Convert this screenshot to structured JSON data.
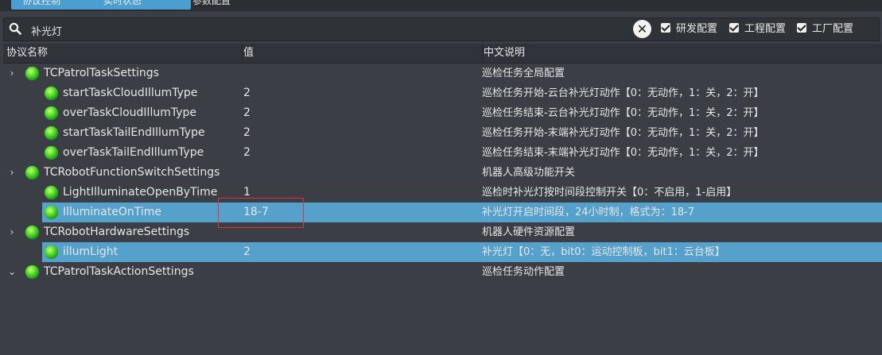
{
  "tabs": [
    {
      "label": "协议控制"
    },
    {
      "label": "实时状态"
    },
    {
      "label": "参数配置"
    }
  ],
  "search": {
    "value": "补光灯",
    "clear_label": "✕"
  },
  "filters": [
    {
      "label": "研发配置",
      "checked": true
    },
    {
      "label": "工程配置",
      "checked": true
    },
    {
      "label": "工厂配置",
      "checked": true
    }
  ],
  "table": {
    "headers": [
      "协议名称",
      "值",
      "中文说明"
    ],
    "rows": [
      {
        "level": 0,
        "expander": "›",
        "name": "TCPatrolTaskSettings",
        "value": "",
        "desc": "巡检任务全局配置"
      },
      {
        "level": 1,
        "name": "startTaskCloudIllumType",
        "value": "2",
        "desc": "巡检任务开始-云台补光灯动作【0：无动作，1：关，2：开】"
      },
      {
        "level": 1,
        "name": "overTaskCloudIllumType",
        "value": "2",
        "desc": "巡检任务结束-云台补光灯动作【0：无动作，1：关，2：开】"
      },
      {
        "level": 1,
        "name": "startTaskTailEndIllumType",
        "value": "2",
        "desc": "巡检任务开始-末端补光灯动作【0：无动作，1：关，2：开】"
      },
      {
        "level": 1,
        "name": "overTaskTailEndIllumType",
        "value": "2",
        "desc": "巡检任务结束-末端补光灯动作【0：无动作，1：关，2：开】"
      },
      {
        "level": 0,
        "expander": "›",
        "name": "TCRobotFunctionSwitchSettings",
        "value": "",
        "desc": "机器人高级功能开关"
      },
      {
        "level": 1,
        "name": "LightIlluminateOpenByTime",
        "value": "1",
        "desc": "巡检时补光灯按时间段控制开关【0：不启用，1-启用】"
      },
      {
        "level": 1,
        "name": "IlluminateOnTime",
        "value": "18-7",
        "desc": "补光灯开启时间段，24小时制，格式为：18-7",
        "selected": true
      },
      {
        "level": 0,
        "expander": "›",
        "name": "TCRobotHardwareSettings",
        "value": "",
        "desc": "机器人硬件资源配置"
      },
      {
        "level": 1,
        "name": "illumLight",
        "value": "2",
        "desc": "补光灯【0：无，bit0：运动控制板，bit1：云台板】",
        "selected": true
      },
      {
        "level": 0,
        "expander": "⌄",
        "name": "TCPatrolTaskActionSettings",
        "value": "",
        "desc": "巡检任务动作配置"
      }
    ]
  },
  "colors": {
    "selection": "#55a1cc",
    "highlight_box": "#e0323c",
    "status_led": "#4cd92a"
  }
}
